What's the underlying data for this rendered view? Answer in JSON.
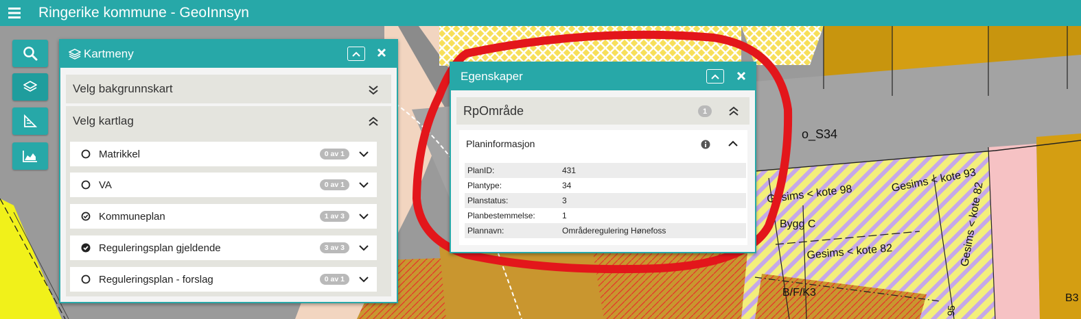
{
  "app": {
    "title": "Ringerike kommune - GeoInnsyn"
  },
  "colors": {
    "accent": "#27a8a8",
    "panel_bg": "#f4f4f4",
    "section_bg": "#e4e4de",
    "badge": "#b9b9b9",
    "highlight_circle": "#e3161b"
  },
  "toolbar": {
    "buttons": [
      "search-icon",
      "layers-icon",
      "measure-icon",
      "profile-chart-icon"
    ]
  },
  "kartmeny": {
    "title": "Kartmeny",
    "bakgrunn_label": "Velg bakgrunnskart",
    "kartlag_label": "Velg kartlag",
    "layers": [
      {
        "label": "Matrikkel",
        "badge": "0 av 1",
        "state": "none"
      },
      {
        "label": "VA",
        "badge": "0 av 1",
        "state": "none"
      },
      {
        "label": "Kommuneplan",
        "badge": "1 av 3",
        "state": "partial"
      },
      {
        "label": "Reguleringsplan gjeldende",
        "badge": "3 av 3",
        "state": "full"
      },
      {
        "label": "Reguleringsplan - forslag",
        "badge": "0 av 1",
        "state": "none"
      }
    ]
  },
  "egenskaper": {
    "title": "Egenskaper",
    "feature_type": "RpOmråde",
    "feature_count": "1",
    "group_title": "Planinformasjon",
    "attributes": [
      {
        "key": "PlanID:",
        "value": "431"
      },
      {
        "key": "Plantype:",
        "value": "34"
      },
      {
        "key": "Planstatus:",
        "value": "3"
      },
      {
        "key": "Planbestemmelse:",
        "value": "1"
      },
      {
        "key": "Plannavn:",
        "value": "Områderegulering Hønefoss"
      }
    ]
  },
  "map_labels": {
    "road": "o_S34",
    "gesims_98": "Gesims < kote 98",
    "gesims_93": "Gesims < kote 93",
    "gesims_82": "Gesims < kote 82",
    "gesims_vertical": "Gesims < kote 82",
    "bygg": "Bygg C",
    "bfk": "B/F/K3",
    "b3": "B3",
    "num_95": "95"
  }
}
